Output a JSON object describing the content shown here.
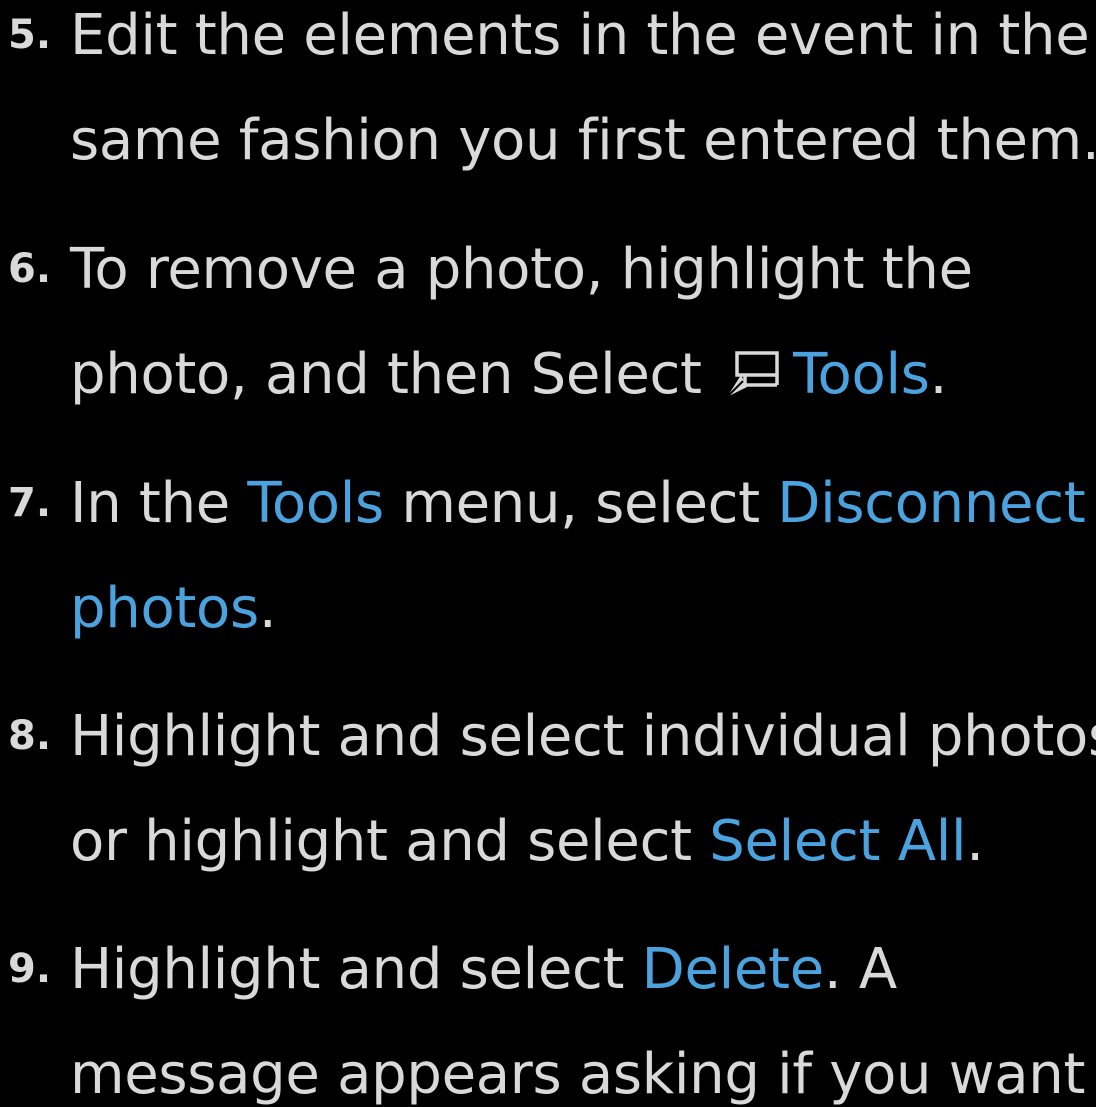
{
  "colors": {
    "background": "#000000",
    "text": "#d9d9d9",
    "highlight": "#4aa3df"
  },
  "steps": [
    {
      "number": "5.",
      "line1": "Edit the elements in the event in the",
      "line2": "same fashion you first entered them."
    },
    {
      "number": "6.",
      "line1": "To remove a photo, highlight the",
      "line2_a": "photo, and then Select ",
      "icon": "tools-remote-icon",
      "line2_tools": "Tools",
      "line2_end": "."
    },
    {
      "number": "7.",
      "line1_a": "In the ",
      "line1_tools": "Tools",
      "line1_b": " menu, select ",
      "line1_disconnect": "Disconnect",
      "line2_photos": "photos",
      "line2_end": "."
    },
    {
      "number": "8.",
      "line1": "Highlight and select individual photos",
      "line2_a": "or highlight and select ",
      "line2_selectall": "Select All",
      "line2_end": "."
    },
    {
      "number": "9.",
      "line1_a": "Highlight and select ",
      "line1_delete": "Delete",
      "line1_b": ". A",
      "line2": "message appears asking if you want"
    }
  ]
}
